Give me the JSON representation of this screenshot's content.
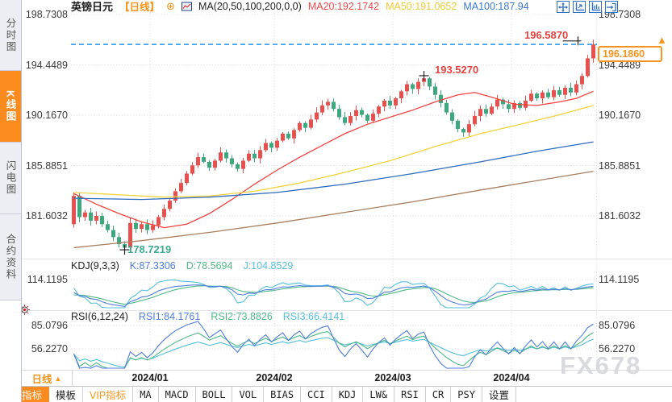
{
  "watermark": "FX678",
  "sidebar": {
    "tabs": [
      {
        "label": "分时图",
        "active": false
      },
      {
        "label": "K线图",
        "active": true
      },
      {
        "label": "闪电图",
        "active": false
      },
      {
        "label": "合约资料",
        "active": false
      }
    ]
  },
  "header": {
    "symbol": "英镑日元",
    "period": "【日线】",
    "ma_settings": "MA(20,50,100,200,0,0)",
    "ma20": "MA20:192.1742",
    "ma50": "MA50:191.0652",
    "ma100": "MA100:187.94",
    "window_icons": [
      "move-icon",
      "axis-pan-icon",
      "axis-fit-icon",
      "exit-right-icon"
    ]
  },
  "icons": {
    "circle_plus": "⊕",
    "triangle_up": "▲",
    "arrow_up": "▲"
  },
  "main_chart": {
    "y_tick_labels": [
      "198.7308",
      "194.4489",
      "190.1670",
      "185.8851",
      "181.6032"
    ],
    "annotations": {
      "high": "196.5870",
      "mid_high": "193.5270",
      "low": "178.7219"
    },
    "current_price": "196.1860"
  },
  "panes": {
    "kdj": {
      "title": "KDJ(9,3,3)",
      "k_value": "K:87.3306",
      "d_value": "D:78.5694",
      "j_value": "J:104.8529",
      "axis_tick": "114.1195"
    },
    "rsi": {
      "title": "RSI(6,12,24)",
      "rsi1_value": "RSI1:84.1761",
      "rsi2_value": "RSI2:73.8826",
      "rsi3_value": "RSI3:66.4141",
      "axis_ticks": [
        "85.0796",
        "56.2270"
      ]
    }
  },
  "x_axis": {
    "period_label": "日线",
    "dates": [
      "2024/01",
      "2024/02",
      "2024/03",
      "2024/04"
    ]
  },
  "toolbar": {
    "items": [
      {
        "label": "指标",
        "active": true
      },
      {
        "label": "模板"
      },
      {
        "label": "VIP指标",
        "vip": true
      },
      {
        "label": "MA"
      },
      {
        "label": "MACD"
      },
      {
        "label": "BOLL"
      },
      {
        "label": "VOL"
      },
      {
        "label": "BIAS"
      },
      {
        "label": "CCI"
      },
      {
        "label": "KDJ"
      },
      {
        "label": "LW&"
      },
      {
        "label": "RSI"
      },
      {
        "label": "CR"
      },
      {
        "label": "PSY"
      },
      {
        "label": "设置"
      }
    ]
  },
  "colors": {
    "accent_orange": "#fb8a1f",
    "price_label_orange": "#f7941d",
    "up_red": "#e7504d",
    "down_green": "#3da87e",
    "dashed_line_blue": "#2196f3",
    "annotation_red": "#e8433f",
    "annotation_teal": "#3cab8e",
    "icon_blue": "#2f6fc1",
    "kdj_k": "#4f7de0",
    "kdj_d": "#4fba85",
    "kdj_j": "#54bede"
  },
  "chart_data": {
    "type": "candlestick",
    "symbol": "英镑日元",
    "period": "日线",
    "open_first": 180.9,
    "closes": [
      183.3,
      181.5,
      181.9,
      181.2,
      181.6,
      180.9,
      180.4,
      179.8,
      179.2,
      178.9,
      181.0,
      180.5,
      180.9,
      180.4,
      180.8,
      181.5,
      182.2,
      182.9,
      183.7,
      184.4,
      185.2,
      185.9,
      186.6,
      186.2,
      185.7,
      186.3,
      187.0,
      186.5,
      186.0,
      185.6,
      186.3,
      186.9,
      186.5,
      187.2,
      187.8,
      187.4,
      188.0,
      188.6,
      188.2,
      188.9,
      189.5,
      189.1,
      189.8,
      190.4,
      191.0,
      191.3,
      190.7,
      190.0,
      189.5,
      190.1,
      190.6,
      190.2,
      189.7,
      190.3,
      190.9,
      191.4,
      191.0,
      191.6,
      192.2,
      192.8,
      192.4,
      193.0,
      193.3,
      192.6,
      191.9,
      191.2,
      190.4,
      189.7,
      189.0,
      188.7,
      189.4,
      190.1,
      190.7,
      190.3,
      190.9,
      191.5,
      191.1,
      190.7,
      191.2,
      190.8,
      191.4,
      192.0,
      191.6,
      192.1,
      191.7,
      192.3,
      191.9,
      192.5,
      192.1,
      192.8,
      193.5,
      195.0,
      196.186
    ],
    "price_axis": {
      "ticks": [
        198.7308,
        194.4489,
        190.167,
        185.8851,
        181.6032
      ]
    },
    "last_price": 196.186,
    "high_marker": {
      "index": 92,
      "price": 196.587
    },
    "mid_marker": {
      "index": 62,
      "price": 193.527
    },
    "low_marker": {
      "index": 9,
      "price": 178.7219
    },
    "month_boundaries": [
      13.5,
      35.5,
      56.5,
      77.5
    ],
    "month_labels": [
      "2024/01",
      "2024/02",
      "2024/03",
      "2024/04"
    ],
    "ma_lines": [
      {
        "name": "MA20",
        "color": "#f0413e",
        "points": [
          [
            0,
            183.5
          ],
          [
            4,
            182.6
          ],
          [
            8,
            181.8
          ],
          [
            12,
            181.1
          ],
          [
            16,
            180.6
          ],
          [
            20,
            180.9
          ],
          [
            24,
            181.8
          ],
          [
            28,
            183.0
          ],
          [
            32,
            184.3
          ],
          [
            36,
            185.5
          ],
          [
            40,
            186.6
          ],
          [
            44,
            187.6
          ],
          [
            48,
            188.6
          ],
          [
            52,
            189.4
          ],
          [
            56,
            190.0
          ],
          [
            60,
            190.6
          ],
          [
            64,
            191.3
          ],
          [
            68,
            191.9
          ],
          [
            71,
            192.1
          ],
          [
            74,
            191.7
          ],
          [
            78,
            191.1
          ],
          [
            82,
            191.0
          ],
          [
            86,
            191.3
          ],
          [
            89,
            191.6
          ],
          [
            92,
            192.2
          ]
        ]
      },
      {
        "name": "MA50",
        "color": "#f3d23c",
        "points": [
          [
            0,
            183.6
          ],
          [
            8,
            183.4
          ],
          [
            16,
            183.2
          ],
          [
            24,
            183.3
          ],
          [
            32,
            183.7
          ],
          [
            40,
            184.4
          ],
          [
            48,
            185.3
          ],
          [
            56,
            186.3
          ],
          [
            64,
            187.5
          ],
          [
            72,
            188.6
          ],
          [
            80,
            189.5
          ],
          [
            86,
            190.2
          ],
          [
            92,
            191.0
          ]
        ]
      },
      {
        "name": "MA100",
        "color": "#2e6bbf",
        "points": [
          [
            0,
            183.1
          ],
          [
            12,
            183.0
          ],
          [
            24,
            183.2
          ],
          [
            36,
            183.6
          ],
          [
            48,
            184.3
          ],
          [
            60,
            185.2
          ],
          [
            72,
            186.2
          ],
          [
            82,
            187.1
          ],
          [
            92,
            187.9
          ]
        ]
      },
      {
        "name": "MA200",
        "color": "#ab7e5e",
        "points": [
          [
            0,
            178.9
          ],
          [
            12,
            179.5
          ],
          [
            24,
            180.2
          ],
          [
            36,
            181.0
          ],
          [
            48,
            181.9
          ],
          [
            60,
            182.8
          ],
          [
            72,
            183.8
          ],
          [
            82,
            184.6
          ],
          [
            92,
            185.4
          ]
        ]
      }
    ],
    "kdj": {
      "params": [
        9,
        3,
        3
      ],
      "last": {
        "k": 87.3306,
        "d": 78.5694,
        "j": 104.8529
      }
    },
    "rsi": {
      "params": [
        6,
        12,
        24
      ],
      "last": {
        "rsi1": 84.1761,
        "rsi2": 73.8826,
        "rsi3": 66.4141
      }
    }
  }
}
